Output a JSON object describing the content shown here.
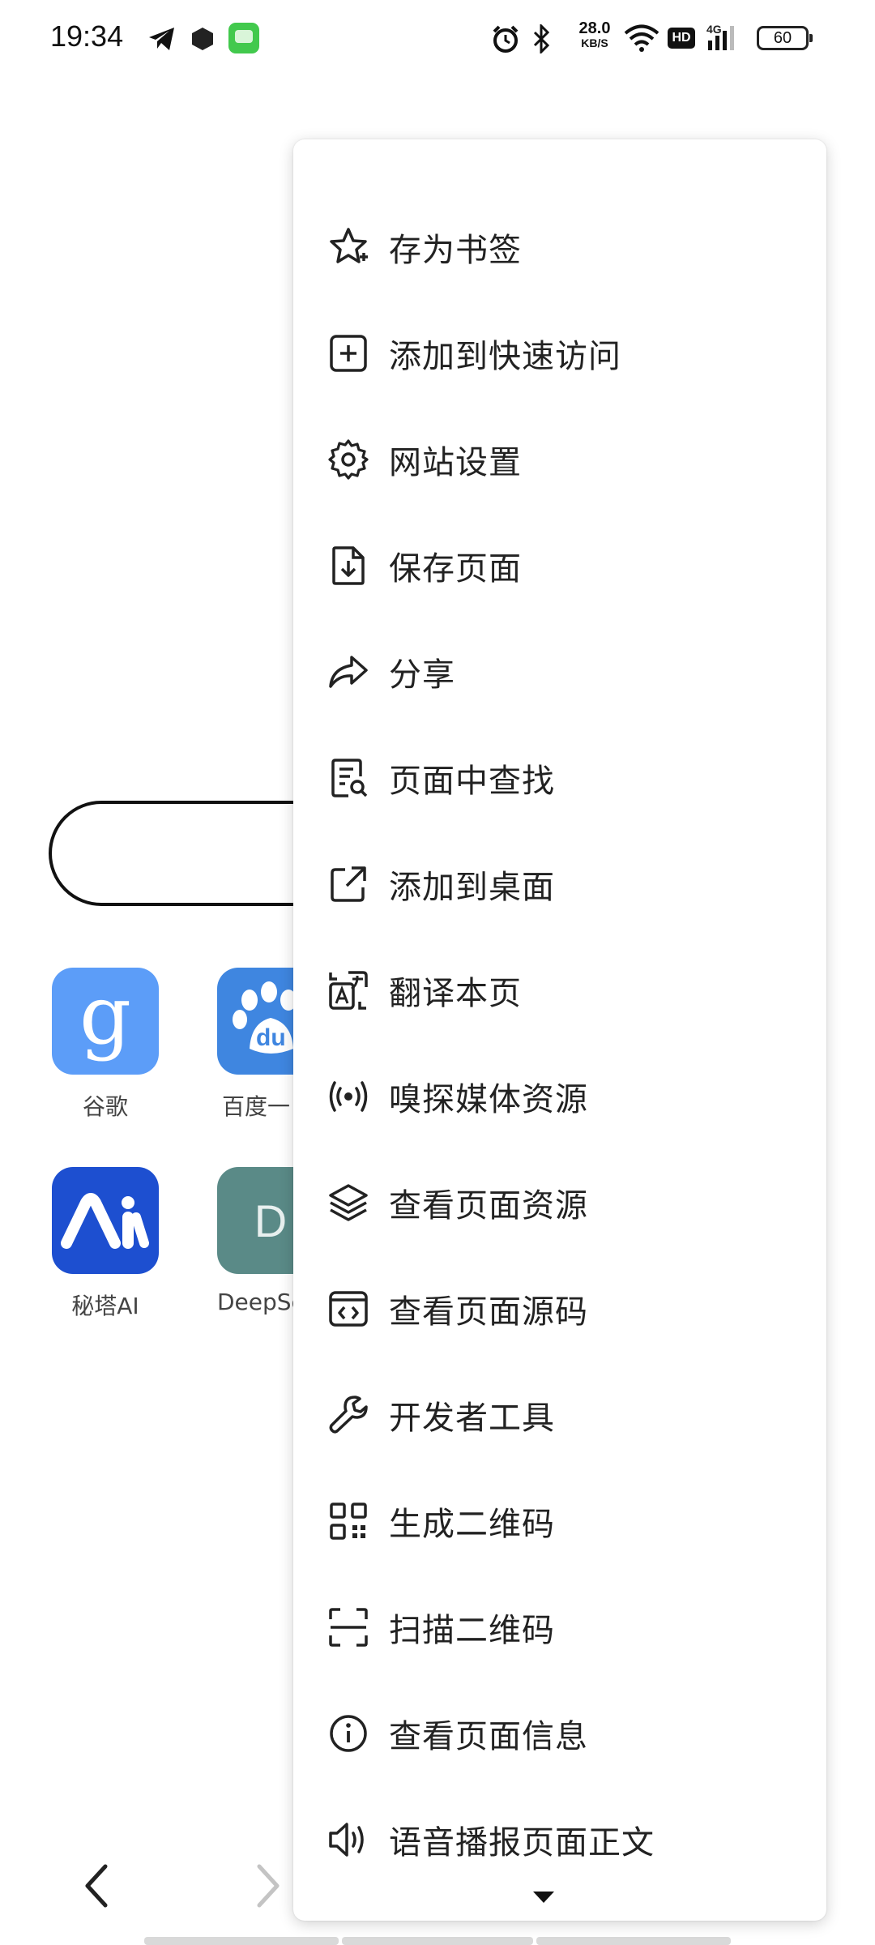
{
  "status_bar": {
    "time": "19:34",
    "net_speed": "28.0",
    "net_speed_unit": "KB/S",
    "network_type": "4G",
    "hd_badge": "HD",
    "battery_level": "60"
  },
  "home": {
    "shortcuts": [
      {
        "label": "谷歌",
        "icon": "google-g-icon",
        "color": "#5c9df8",
        "glyph": "g"
      },
      {
        "label": "百度一",
        "icon": "baidu-paw-icon",
        "color": "#3f86e0",
        "glyph": "du"
      },
      {
        "label": "秘塔AI",
        "icon": "metaso-icon",
        "color": "#1d4fd0"
      },
      {
        "label": "DeepSe",
        "icon": "deepseek-letter-icon",
        "color": "#5a8a87",
        "glyph": "D"
      }
    ]
  },
  "menu": {
    "items": [
      {
        "label": "存为书签",
        "icon": "star-plus-icon"
      },
      {
        "label": "添加到快速访问",
        "icon": "square-plus-icon"
      },
      {
        "label": "网站设置",
        "icon": "gear-icon"
      },
      {
        "label": "保存页面",
        "icon": "file-download-icon"
      },
      {
        "label": "分享",
        "icon": "share-arrow-icon"
      },
      {
        "label": "页面中查找",
        "icon": "find-in-page-icon"
      },
      {
        "label": "添加到桌面",
        "icon": "open-external-icon"
      },
      {
        "label": "翻译本页",
        "icon": "translate-icon"
      },
      {
        "label": "嗅探媒体资源",
        "icon": "broadcast-icon"
      },
      {
        "label": "查看页面资源",
        "icon": "layers-icon"
      },
      {
        "label": "查看页面源码",
        "icon": "code-window-icon"
      },
      {
        "label": "开发者工具",
        "icon": "wrench-icon"
      },
      {
        "label": "生成二维码",
        "icon": "qr-code-icon"
      },
      {
        "label": "扫描二维码",
        "icon": "scan-frame-icon"
      },
      {
        "label": "查看页面信息",
        "icon": "info-circle-icon"
      },
      {
        "label": "语音播报页面正文",
        "icon": "speaker-icon"
      }
    ]
  }
}
